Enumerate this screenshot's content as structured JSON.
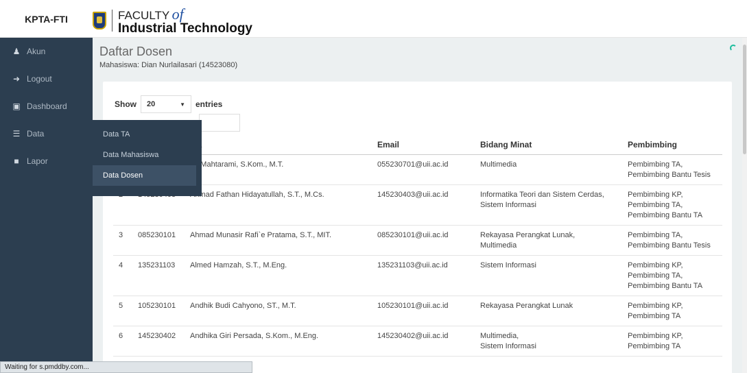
{
  "header": {
    "brand": "KPTA-FTI",
    "logo_line1": "FACULTY",
    "logo_of": "of",
    "logo_line2": "Industrial Technology"
  },
  "sidebar": {
    "items": [
      {
        "label": "Akun",
        "icon": "user-icon"
      },
      {
        "label": "Logout",
        "icon": "logout-icon"
      },
      {
        "label": "Dashboard",
        "icon": "dashboard-icon"
      },
      {
        "label": "Data",
        "icon": "list-icon"
      },
      {
        "label": "Lapor",
        "icon": "comment-icon"
      }
    ]
  },
  "dropdown": {
    "items": [
      "Data TA",
      "Data Mahasiswa",
      "Data Dosen"
    ]
  },
  "page": {
    "title": "Daftar Dosen",
    "subtitle": "Mahasiswa: Dian Nurlailasari (14523080)"
  },
  "table_controls": {
    "show_label": "Show",
    "entries_value": "20",
    "entries_label": "entries"
  },
  "table": {
    "headers": [
      "",
      "",
      "ma",
      "Email",
      "Bidang Minat",
      "Pembimbing"
    ],
    "rows": [
      {
        "no": "",
        "nik": "",
        "nama": "an Mahtarami, S.Kom., M.T.",
        "email": "055230701@uii.ac.id",
        "bidang": [
          "Multimedia"
        ],
        "pembimbing": [
          "Pembimbing TA,",
          "Pembimbing Bantu Tesis"
        ]
      },
      {
        "no": "2",
        "nik": "145230403",
        "nama": "Ahmad Fathan Hidayatullah, S.T., M.Cs.",
        "email": "145230403@uii.ac.id",
        "bidang": [
          "Informatika Teori dan Sistem Cerdas,",
          "Sistem Informasi"
        ],
        "pembimbing": [
          "Pembimbing KP,",
          "Pembimbing TA,",
          "Pembimbing Bantu TA"
        ]
      },
      {
        "no": "3",
        "nik": "085230101",
        "nama": "Ahmad Munasir Rafi`e Pratama, S.T., MIT.",
        "email": "085230101@uii.ac.id",
        "bidang": [
          "Rekayasa Perangkat Lunak,",
          "Multimedia"
        ],
        "pembimbing": [
          "Pembimbing TA,",
          "Pembimbing Bantu Tesis"
        ]
      },
      {
        "no": "4",
        "nik": "135231103",
        "nama": "Almed Hamzah, S.T., M.Eng.",
        "email": "135231103@uii.ac.id",
        "bidang": [
          "Sistem Informasi"
        ],
        "pembimbing": [
          "Pembimbing KP,",
          "Pembimbing TA,",
          "Pembimbing Bantu TA"
        ]
      },
      {
        "no": "5",
        "nik": "105230101",
        "nama": "Andhik Budi Cahyono, ST., M.T.",
        "email": "105230101@uii.ac.id",
        "bidang": [
          "Rekayasa Perangkat Lunak"
        ],
        "pembimbing": [
          "Pembimbing KP,",
          "Pembimbing TA"
        ]
      },
      {
        "no": "6",
        "nik": "145230402",
        "nama": "Andhika Giri Persada, S.Kom., M.Eng.",
        "email": "145230402@uii.ac.id",
        "bidang": [
          "Multimedia,",
          "Sistem Informasi"
        ],
        "pembimbing": [
          "Pembimbing KP,",
          "Pembimbing TA"
        ]
      }
    ]
  },
  "statusbar": {
    "text": "Waiting for s.pmddby.com..."
  }
}
